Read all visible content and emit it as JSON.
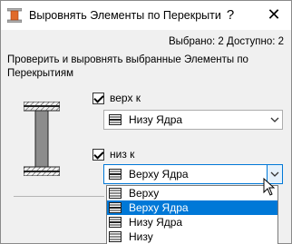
{
  "dialog": {
    "title": "Выровнять Элементы по Перекрыти",
    "help_label": "?",
    "close_label": "✕"
  },
  "stats": {
    "text": "Выбрано: 2  Доступно: 2"
  },
  "description": "Проверить и выровнять выбранные Элементы по Перекрытиям",
  "top": {
    "checkbox_label": "верх к",
    "checked": true,
    "selected": "Низу Ядра"
  },
  "bottom": {
    "checkbox_label": "низ к",
    "checked": true,
    "selected": "Верху Ядра"
  },
  "dropdown_options": [
    "Верху",
    "Верху Ядра",
    "Низу Ядра",
    "Низу"
  ],
  "colors": {
    "accent": "#0078d7",
    "selection": "#0078d7",
    "window_bg": "#f0f0f0"
  },
  "icons": {
    "app": "align-elements-icon",
    "beam": "i-beam-diagram-icon",
    "dropdown_arrow": "chevron-down-icon"
  }
}
